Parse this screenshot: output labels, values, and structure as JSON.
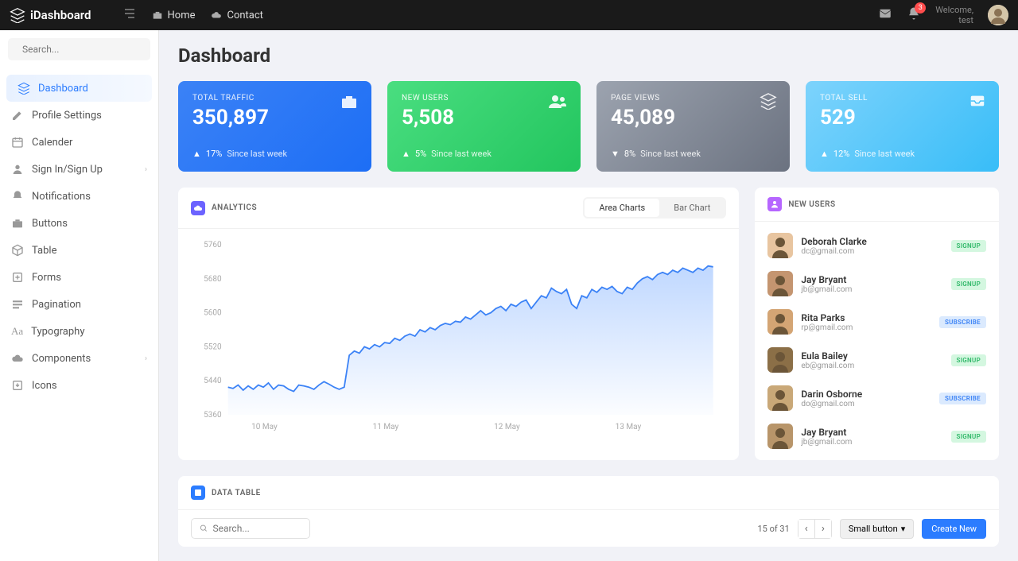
{
  "app": {
    "name": "iDashboard"
  },
  "topnav": {
    "home": "Home",
    "contact": "Contact"
  },
  "topright": {
    "notif_count": "3",
    "welcome": "Welcome,",
    "user": "test"
  },
  "search": {
    "placeholder": "Search..."
  },
  "sidebar": {
    "items": [
      {
        "label": "Dashboard"
      },
      {
        "label": "Profile Settings"
      },
      {
        "label": "Calender"
      },
      {
        "label": "Sign In/Sign Up"
      },
      {
        "label": "Notifications"
      },
      {
        "label": "Buttons"
      },
      {
        "label": "Table"
      },
      {
        "label": "Forms"
      },
      {
        "label": "Pagination"
      },
      {
        "label": "Typography"
      },
      {
        "label": "Components"
      },
      {
        "label": "Icons"
      }
    ]
  },
  "page": {
    "title": "Dashboard"
  },
  "stats": [
    {
      "label": "TOTAL TRAFFIC",
      "value": "350,897",
      "delta": "17%",
      "since": "Since last week",
      "dir": "up"
    },
    {
      "label": "NEW USERS",
      "value": "5,508",
      "delta": "5%",
      "since": "Since last week",
      "dir": "up"
    },
    {
      "label": "PAGE VIEWS",
      "value": "45,089",
      "delta": "8%",
      "since": "Since last week",
      "dir": "down"
    },
    {
      "label": "TOTAL SELL",
      "value": "529",
      "delta": "12%",
      "since": "Since last week",
      "dir": "up"
    }
  ],
  "analytics": {
    "title": "ANALYTICS",
    "tabs": {
      "area": "Area Charts",
      "bar": "Bar Chart"
    }
  },
  "chart_data": {
    "type": "area",
    "title": "Analytics",
    "xlabel": "",
    "ylabel": "",
    "ylim": [
      5360,
      5760
    ],
    "x_ticks": [
      "10 May",
      "11 May",
      "12 May",
      "13 May"
    ],
    "y_ticks": [
      5360,
      5440,
      5520,
      5600,
      5680,
      5760
    ],
    "series": [
      {
        "name": "value",
        "values": [
          5425,
          5422,
          5430,
          5418,
          5428,
          5420,
          5430,
          5425,
          5435,
          5420,
          5430,
          5428,
          5420,
          5415,
          5430,
          5428,
          5425,
          5420,
          5430,
          5438,
          5432,
          5425,
          5420,
          5425,
          5500,
          5510,
          5505,
          5520,
          5515,
          5525,
          5520,
          5530,
          5528,
          5540,
          5535,
          5545,
          5550,
          5545,
          5560,
          5555,
          5565,
          5560,
          5570,
          5575,
          5572,
          5580,
          5578,
          5590,
          5585,
          5595,
          5605,
          5595,
          5600,
          5610,
          5615,
          5605,
          5620,
          5615,
          5625,
          5630,
          5610,
          5625,
          5640,
          5635,
          5658,
          5650,
          5645,
          5655,
          5620,
          5610,
          5640,
          5635,
          5655,
          5648,
          5660,
          5655,
          5662,
          5650,
          5645,
          5660,
          5655,
          5670,
          5680,
          5685,
          5678,
          5690,
          5695,
          5690,
          5700,
          5695,
          5705,
          5700,
          5695,
          5705,
          5700,
          5710,
          5708
        ]
      }
    ]
  },
  "newusers_panel": {
    "title": "NEW USERS"
  },
  "newusers": [
    {
      "name": "Deborah Clarke",
      "email": "dc@gmail.com",
      "tag": "SIGNUP",
      "type": "signup"
    },
    {
      "name": "Jay Bryant",
      "email": "jb@gmail.com",
      "tag": "SIGNUP",
      "type": "signup"
    },
    {
      "name": "Rita Parks",
      "email": "rp@gmail.com",
      "tag": "SUBSCRIBE",
      "type": "subscribe"
    },
    {
      "name": "Eula Bailey",
      "email": "eb@gmail.com",
      "tag": "SIGNUP",
      "type": "signup"
    },
    {
      "name": "Darin Osborne",
      "email": "do@gmail.com",
      "tag": "SUBSCRIBE",
      "type": "subscribe"
    },
    {
      "name": "Jay Bryant",
      "email": "jb@gmail.com",
      "tag": "SIGNUP",
      "type": "signup"
    }
  ],
  "datatable": {
    "title": "DATA TABLE",
    "search_placeholder": "Search...",
    "page_info": "15 of 31",
    "small_btn": "Small button",
    "create_btn": "Create New"
  }
}
